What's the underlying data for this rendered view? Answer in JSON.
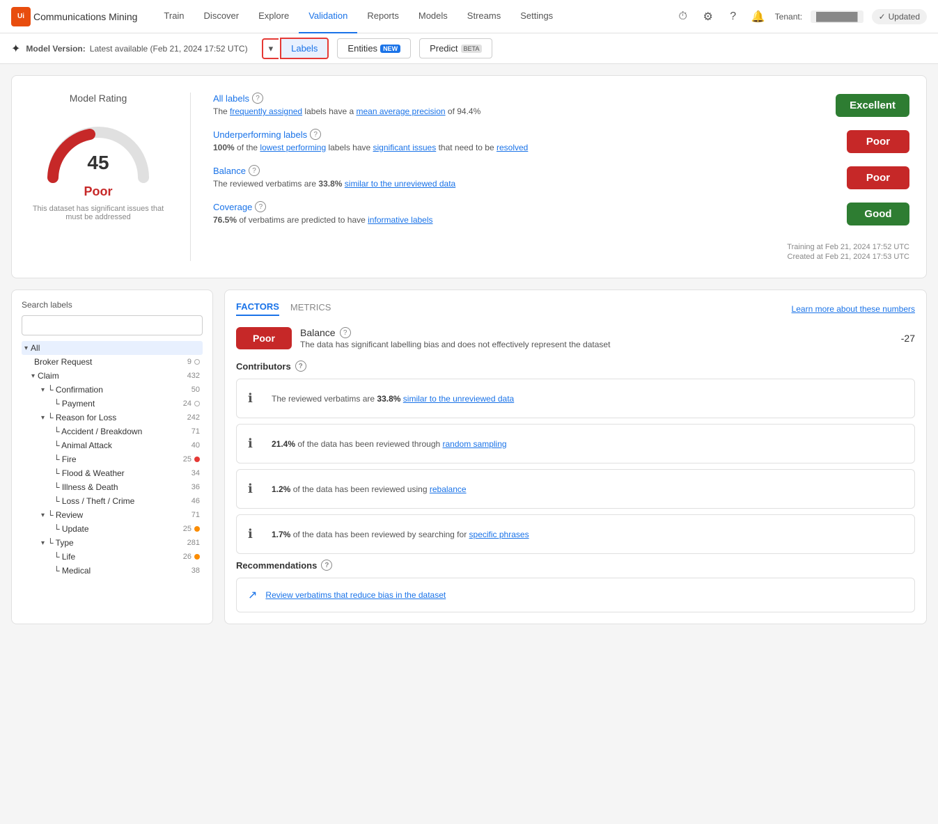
{
  "brand": {
    "logo_text": "Ui",
    "app_name": "Communications Mining"
  },
  "nav": {
    "items": [
      {
        "label": "Train",
        "active": false
      },
      {
        "label": "Discover",
        "active": false
      },
      {
        "label": "Explore",
        "active": false
      },
      {
        "label": "Validation",
        "active": true
      },
      {
        "label": "Reports",
        "active": false
      },
      {
        "label": "Models",
        "active": false
      },
      {
        "label": "Streams",
        "active": false
      },
      {
        "label": "Settings",
        "active": false
      }
    ],
    "updated_label": "Updated",
    "tenant_label": "Tenant:"
  },
  "subtitle": {
    "model_version_label": "Model Version:",
    "model_version_value": "Latest available (Feb 21, 2024 17:52 UTC)",
    "tabs": {
      "dropdown_label": "▾",
      "labels_label": "Labels",
      "entities_label": "Entities",
      "entities_badge": "NEW",
      "predict_label": "Predict",
      "predict_badge": "BETA"
    }
  },
  "rating_card": {
    "title": "Model Rating",
    "score": "45",
    "label": "Poor",
    "description": "This dataset has significant issues that must be addressed",
    "metrics": [
      {
        "title": "All labels",
        "desc_prefix": "The ",
        "desc_link1": "frequently assigned",
        "desc_mid": " labels have a ",
        "desc_link2": "mean average precision",
        "desc_suffix": " of 94.4%",
        "badge": "Excellent",
        "badge_class": "badge-excellent"
      },
      {
        "title": "Underperforming labels",
        "desc_prefix": "",
        "desc_bold": "100%",
        "desc_mid": " of the ",
        "desc_link1": "lowest performing",
        "desc_suffix": " labels have ",
        "desc_link2": "significant issues",
        "desc_end": " that need to be resolved",
        "badge": "Poor",
        "badge_class": "badge-poor"
      },
      {
        "title": "Balance",
        "desc": "The reviewed verbatims are 33.8% similar to the unreviewed data",
        "badge": "Poor",
        "badge_class": "badge-poor"
      },
      {
        "title": "Coverage",
        "desc": "76.5% of verbatims are predicted to have informative labels",
        "badge": "Good",
        "badge_class": "badge-good"
      }
    ],
    "footer": {
      "training": "Training at Feb 21, 2024 17:52 UTC",
      "created": "Created at Feb 21, 2024 17:53 UTC"
    }
  },
  "labels_sidebar": {
    "search_label": "Search labels",
    "search_placeholder": "",
    "items": [
      {
        "indent": 0,
        "chevron": "▾",
        "name": "All",
        "count": "",
        "dot": "none",
        "selected": true
      },
      {
        "indent": 1,
        "chevron": "",
        "name": "Broker Request",
        "count": "9",
        "dot": "outline"
      },
      {
        "indent": 1,
        "chevron": "▾",
        "name": "Claim",
        "count": "432",
        "dot": "none"
      },
      {
        "indent": 2,
        "chevron": "▾",
        "name": "└ Confirmation",
        "count": "50",
        "dot": "none"
      },
      {
        "indent": 3,
        "chevron": "",
        "name": "└ Payment",
        "count": "24",
        "dot": "outline"
      },
      {
        "indent": 2,
        "chevron": "▾",
        "name": "└ Reason for Loss",
        "count": "242",
        "dot": "none"
      },
      {
        "indent": 3,
        "chevron": "",
        "name": "└ Accident / Breakdown",
        "count": "71",
        "dot": "none"
      },
      {
        "indent": 3,
        "chevron": "",
        "name": "└ Animal Attack",
        "count": "40",
        "dot": "none"
      },
      {
        "indent": 3,
        "chevron": "",
        "name": "└ Fire",
        "count": "25",
        "dot": "red"
      },
      {
        "indent": 3,
        "chevron": "",
        "name": "└ Flood & Weather",
        "count": "34",
        "dot": "none"
      },
      {
        "indent": 3,
        "chevron": "",
        "name": "└ Illness & Death",
        "count": "36",
        "dot": "none"
      },
      {
        "indent": 3,
        "chevron": "",
        "name": "└ Loss / Theft / Crime",
        "count": "46",
        "dot": "none"
      },
      {
        "indent": 2,
        "chevron": "▾",
        "name": "└ Review",
        "count": "71",
        "dot": "none"
      },
      {
        "indent": 3,
        "chevron": "",
        "name": "└ Update",
        "count": "25",
        "dot": "orange"
      },
      {
        "indent": 2,
        "chevron": "▾",
        "name": "└ Type",
        "count": "281",
        "dot": "none"
      },
      {
        "indent": 3,
        "chevron": "",
        "name": "└ Life",
        "count": "26",
        "dot": "orange"
      },
      {
        "indent": 3,
        "chevron": "",
        "name": "└ Medical",
        "count": "38",
        "dot": "none"
      }
    ]
  },
  "factors_panel": {
    "factors_tab": "FACTORS",
    "metrics_tab": "METRICS",
    "learn_more": "Learn more about these numbers",
    "balance": {
      "badge": "Poor",
      "label": "Balance",
      "score": "-27",
      "description": "The data has significant labelling bias and does not effectively represent the dataset"
    },
    "contributors_title": "Contributors",
    "contributors": [
      {
        "text_prefix": "The reviewed verbatims are ",
        "text_bold": "33.8%",
        "text_mid": " ",
        "text_link": "similar to the unreviewed data",
        "text_suffix": ""
      },
      {
        "text_prefix": "",
        "text_bold": "21.4%",
        "text_mid": " of the data has been reviewed through ",
        "text_link": "random sampling",
        "text_suffix": ""
      },
      {
        "text_prefix": "",
        "text_bold": "1.2%",
        "text_mid": " of the data has been reviewed using ",
        "text_link": "rebalance",
        "text_suffix": ""
      },
      {
        "text_prefix": "",
        "text_bold": "1.7%",
        "text_mid": " of the data has been reviewed by searching for ",
        "text_link": "specific phrases",
        "text_suffix": ""
      }
    ],
    "recommendations_title": "Recommendations",
    "recommendations": [
      {
        "icon": "↗",
        "text": "Review verbatims that reduce bias in the dataset"
      }
    ]
  }
}
